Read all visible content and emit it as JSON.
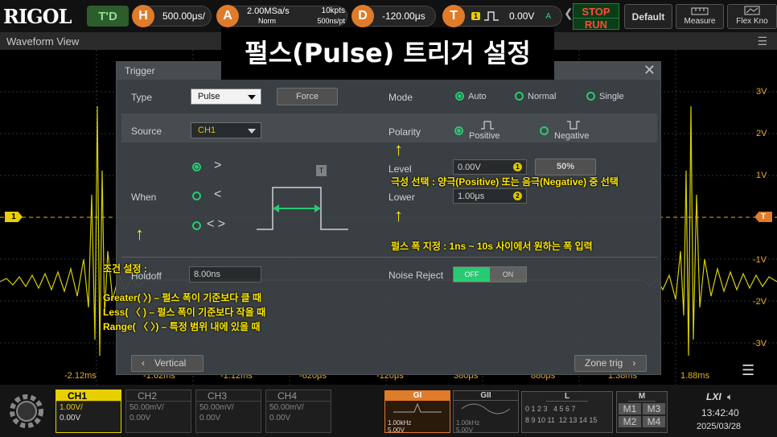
{
  "topbar": {
    "logo": "RIGOL",
    "trig_status": "T'D",
    "h_label": "H",
    "timebase": "500.00μs/",
    "a_label": "A",
    "sample_rate": "2.00MSa/s",
    "mem_depth": "10kpts",
    "acq_mode": "Norm",
    "pts_rate": "500ns/pt",
    "d_label": "D",
    "delay": "-120.00μs",
    "t_label": "T",
    "trig_src_badge": "1",
    "trig_level": "0.00V",
    "trig_mode_letter": "A",
    "stop": "STOP",
    "run": "RUN",
    "default": "Default",
    "measure": "Measure",
    "flex": "Flex Kno"
  },
  "waveform_view": {
    "title": "Waveform View"
  },
  "volt_labels": [
    "3V",
    "2V",
    "1V",
    "-1V",
    "-2V",
    "-3V"
  ],
  "time_labels": [
    "-2.12ms",
    "-1.62ms",
    "-1.12ms",
    "-620μs",
    "-120μs",
    "380μs",
    "880μs",
    "1.38ms",
    "1.88ms"
  ],
  "trigger_marker_left": "1",
  "trigger_marker_right": "T",
  "title_overlay": "펄스(Pulse) 트리거 설정",
  "dialog": {
    "title": "Trigger",
    "type_label": "Type",
    "type_value": "Pulse",
    "force_label": "Force",
    "mode_label": "Mode",
    "mode_options": [
      "Auto",
      "Normal",
      "Single"
    ],
    "source_label": "Source",
    "source_value": "CH1",
    "polarity_label": "Polarity",
    "polarity_options": [
      "Positive",
      "Negative"
    ],
    "when_label": "When",
    "when_options": [
      ">",
      "<",
      "< >"
    ],
    "level_label": "Level",
    "level_value": "0.00V",
    "level_badge": "1",
    "level_percent": "50%",
    "lower_label": "Lower",
    "lower_value": "1.00μs",
    "lower_badge": "2",
    "holdoff_label": "Holdoff",
    "holdoff_value": "8.00ns",
    "noise_label": "Noise Reject",
    "noise_off": "OFF",
    "noise_on": "ON",
    "vertical_btn": "Vertical",
    "zone_btn": "Zone trig",
    "t_marker": "T"
  },
  "annotations": {
    "polarity_note": "극성 선택 : 양극(Positive) 또는 음극(Negative) 중 선택",
    "width_note": "펄스 폭 지정 : 1ns ~ 10s 사이에서 원하는 폭 입력",
    "cond_title": "조건 설정 :",
    "cond_1": "Greater( 〉) – 펄스 폭이 기준보다 클 때",
    "cond_2": "Less( 〈 ) – 펄스 폭이 기준보다 작을 때",
    "cond_3": "Range( 〈 〉) – 특정 범위 내에 있을 때"
  },
  "bottom": {
    "channels": [
      {
        "name": "CH1",
        "scale": "1.00V/",
        "offset": "0.00V"
      },
      {
        "name": "CH2",
        "scale": "50.00mV/",
        "offset": "0.00V"
      },
      {
        "name": "CH3",
        "scale": "50.00mV/",
        "offset": "0.00V"
      },
      {
        "name": "CH4",
        "scale": "50.00mV/",
        "offset": "0.00V"
      }
    ],
    "gi": {
      "name": "GI",
      "freq": "1.00kHz",
      "amp": "5.00V"
    },
    "gii": {
      "name": "GII",
      "freq": "1.00kHz",
      "amp": "5.00V"
    },
    "l_label": "L",
    "l_row1": "0 1 2 3   4 5 6 7",
    "l_row2": "8 9 10 11  12 13 14 15",
    "m_label": "M",
    "m_items": [
      "M1",
      "M3",
      "M2",
      "M4"
    ],
    "lxi": "LXI",
    "time": "13:42:40",
    "date": "2025/03/28"
  }
}
